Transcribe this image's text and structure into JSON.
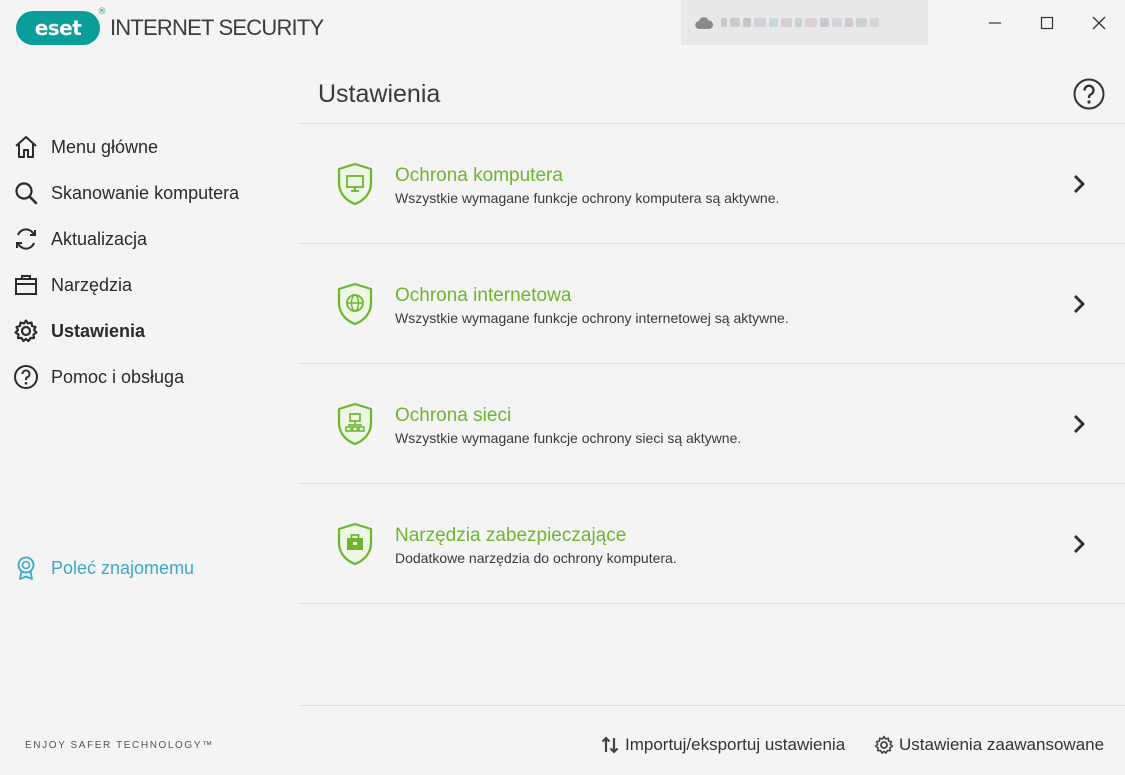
{
  "app": {
    "brand": "eset",
    "product_name": "INTERNET SECURITY",
    "reg_mark": "®",
    "brand_color": "#0a9e9a",
    "accent_color": "#6db52f",
    "link_color": "#3aa9c7"
  },
  "window_controls": {
    "minimize_icon": "minimize-icon",
    "maximize_icon": "maximize-icon",
    "close_icon": "close-icon"
  },
  "sidebar": {
    "items": [
      {
        "label": "Menu główne",
        "icon": "home-icon",
        "active": false
      },
      {
        "label": "Skanowanie komputera",
        "icon": "search-icon",
        "active": false
      },
      {
        "label": "Aktualizacja",
        "icon": "refresh-icon",
        "active": false
      },
      {
        "label": "Narzędzia",
        "icon": "toolbox-icon",
        "active": false
      },
      {
        "label": "Ustawienia",
        "icon": "gear-icon",
        "active": true
      },
      {
        "label": "Pomoc i obsługa",
        "icon": "question-icon",
        "active": false
      }
    ],
    "refer": {
      "label": "Poleć znajomemu",
      "icon": "badge-icon"
    },
    "tagline": "ENJOY SAFER TECHNOLOGY™"
  },
  "main": {
    "title": "Ustawienia",
    "sections": [
      {
        "title": "Ochrona komputera",
        "desc": "Wszystkie wymagane funkcje ochrony komputera są aktywne.",
        "icon": "shield-monitor-icon"
      },
      {
        "title": "Ochrona internetowa",
        "desc": "Wszystkie wymagane funkcje ochrony internetowej są aktywne.",
        "icon": "shield-globe-icon"
      },
      {
        "title": "Ochrona sieci",
        "desc": "Wszystkie wymagane funkcje ochrony sieci są aktywne.",
        "icon": "shield-network-icon"
      },
      {
        "title": "Narzędzia zabezpieczające",
        "desc": "Dodatkowe narzędzia do ochrony komputera.",
        "icon": "shield-briefcase-icon"
      }
    ],
    "footer": {
      "import_export": "Importuj/eksportuj ustawienia",
      "advanced": "Ustawienia zaawansowane"
    }
  }
}
